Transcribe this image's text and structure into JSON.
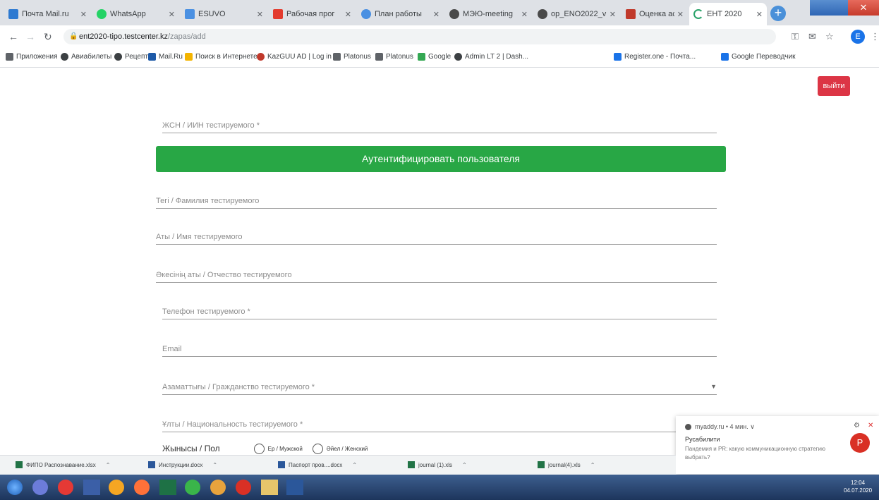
{
  "browser": {
    "tabs": [
      {
        "label": "Почта Mail.ru",
        "color": "#2e7ad1",
        "icon": "mail-icon"
      },
      {
        "label": "WhatsApp",
        "color": "#25d366",
        "icon": "whatsapp-icon"
      },
      {
        "label": "ESUVO",
        "color": "#4a90e2",
        "icon": "esuvo-icon"
      },
      {
        "label": "Рабочая прог",
        "color": "#e33b2e",
        "icon": "yandex-icon"
      },
      {
        "label": "План работы",
        "color": "#4a90e2",
        "icon": "plan-icon"
      },
      {
        "label": "МЭЮ-meeting",
        "color": "#4a4a4a",
        "icon": "globe-icon"
      },
      {
        "label": "op_ENO2022_v",
        "color": "#4a4a4a",
        "icon": "globe-icon"
      },
      {
        "label": "Оценка action",
        "color": "#c0392b",
        "icon": "gmail-icon"
      },
      {
        "label": "ЕНТ 2020",
        "color": "#2aa36a",
        "icon": "loading-icon"
      }
    ],
    "url_host": "ent2020-tipo.testcenter.kz",
    "url_path": "/zapas/add",
    "profile_initial": "E"
  },
  "bookmarks": [
    {
      "label": "Приложения",
      "color": "#5f6368",
      "icon": "apps-icon"
    },
    {
      "label": "Авиабилеты",
      "color": "#3c4043",
      "icon": "globe-icon"
    },
    {
      "label": "Рецепт",
      "color": "#3c4043",
      "icon": "globe-icon"
    },
    {
      "label": "Mail.Ru",
      "color": "#1e5aa8",
      "icon": "mail-icon"
    },
    {
      "label": "Поиск в Интернете",
      "color": "#f4b400",
      "icon": "search-icon"
    },
    {
      "label": "KazGUU AD | Log in",
      "color": "#c0392b",
      "icon": "kazguu-icon"
    },
    {
      "label": "Platonus",
      "color": "#5f6368",
      "icon": "folder-icon"
    },
    {
      "label": "Platonus",
      "color": "#5f6368",
      "icon": "folder-icon"
    },
    {
      "label": "Google",
      "color": "#34a853",
      "icon": "google-icon"
    },
    {
      "label": "Admin LT 2 | Dash...",
      "color": "#3c4043",
      "icon": "globe-icon"
    },
    {
      "label": "Register.one - Почта...",
      "color": "#1a73e8",
      "icon": "mail-icon"
    },
    {
      "label": "Google Переводчик",
      "color": "#1a73e8",
      "icon": "translate-icon"
    }
  ],
  "page": {
    "logout_label": "выйти",
    "iin_label": "ЖСН / ИИН тестируемого *",
    "auth_button": "Аутентифицировать пользователя",
    "lastname_label": "Тегі / Фамилия тестируемого",
    "firstname_label": "Аты / Имя тестируемого",
    "middlename_label": "Әкесінің аты / Отчество тестируемого",
    "phone_label": "Телефон тестируемого *",
    "email_label": "Email",
    "citizenship_label": "Азаматтығы / Гражданство тестируемого *",
    "nationality_label": "Ұлты / Национальность тестируемого *",
    "gender_label": "Жынысы / Пол",
    "gender_male": "Ер / Мужской",
    "gender_female": "Әйел / Женский"
  },
  "notification": {
    "source": "myaddy.ru • 4 мин. ∨",
    "title": "Русабилити",
    "body": "Пандемия и PR: какую коммуникационную стратегию выбрать?",
    "avatar_letter": "P"
  },
  "downloads": [
    "ФИПО Распознавание.xlsx",
    "Инструкции.docx",
    "Паспорт пров....docx",
    "journal (1).xls",
    "journal(4).xls"
  ],
  "taskbar": {
    "clock_time": "12:04",
    "clock_date": "04.07.2020"
  }
}
